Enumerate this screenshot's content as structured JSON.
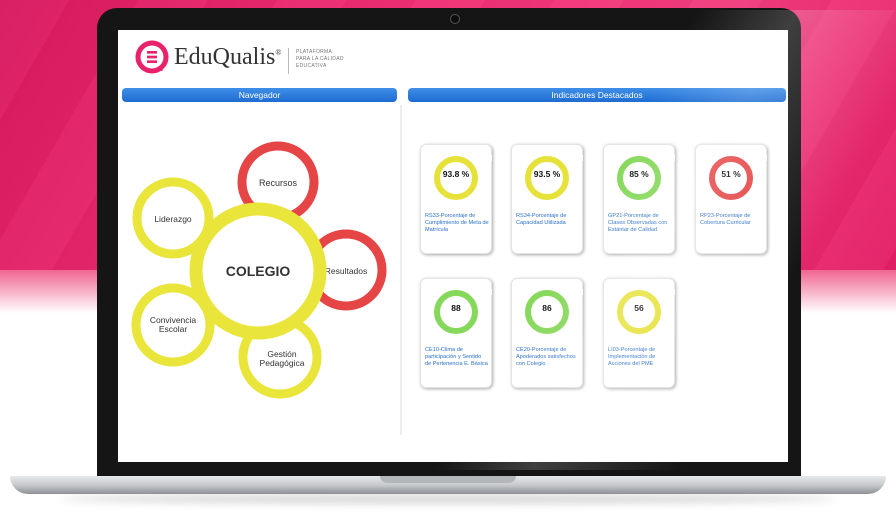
{
  "brand": {
    "name": "EduQualis",
    "trademark": "®",
    "tagline": [
      "PLATAFORMA",
      "PARA LA CALIDAD",
      "EDUCATIVA"
    ],
    "accent": "#e8226b"
  },
  "panels": {
    "navigator_title": "Navegador",
    "indicators_title": "Indicadores Destacados"
  },
  "navigator": {
    "center": "COLEGIO",
    "petals": [
      {
        "label": "Recursos",
        "color": "#e64545"
      },
      {
        "label": "Liderazgo",
        "color": "#e9e53a"
      },
      {
        "label": "Resultados",
        "color": "#e64545"
      },
      {
        "label": "Convivencia Escolar",
        "color": "#e9e53a"
      },
      {
        "label": "Gestión Pedagógica",
        "color": "#e9e53a"
      }
    ]
  },
  "indicators": [
    {
      "value": "93.8 %",
      "label": "RS33-Porcentaje de Cumplimiento de Meta de Matrícula",
      "color": "#e6e23a"
    },
    {
      "value": "93.5 %",
      "label": "RS34-Porcentaje de Capacidad Utilizada",
      "color": "#e6e23a"
    },
    {
      "value": "85 %",
      "label": "GP21-Porcentaje de Clases Observadas con Estántar de Calidad",
      "color": "#86d85a"
    },
    {
      "value": "51 %",
      "label": "RP23-Porcentaje de Cobertura Curricular",
      "color": "#e64545"
    },
    {
      "value": "88",
      "label": "CE10-Clima de participación y Sentido de Pertenencia E. Básica",
      "color": "#86d85a"
    },
    {
      "value": "86",
      "label": "CE20-Porcentaje de Apoderados satisfechos con Colegio",
      "color": "#86d85a"
    },
    {
      "value": "56",
      "label": "LI03-Porcentaje de Implementación de Acciones del PME",
      "color": "#e6e23a"
    }
  ]
}
